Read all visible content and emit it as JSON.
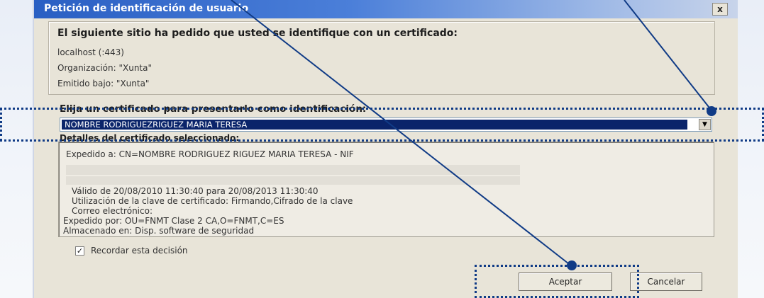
{
  "dialog": {
    "title": "Petición de identificación de usuario",
    "close_label": "x"
  },
  "site_info": {
    "heading": "El siguiente sitio ha pedido que usted se identifique con un certificado:",
    "host": "localhost (:443)",
    "organization": "Organización: \"Xunta\"",
    "issued_under": "Emitido bajo: \"Xunta\""
  },
  "certificate": {
    "choose_label": "Elija un certificado para presentarlo como identificación:",
    "selected": "NOMBRE RODRIGUEZRIGUEZ MARIA TERESA",
    "details_label": "Detalles del certificado seleccionado:",
    "details": [
      "Expedido a: CN=NOMBRE RODRIGUEZ RIGUEZ MARIA TERESA - NIF",
      "Válido de 20/08/2010 11:30:40 para 20/08/2013 11:30:40",
      "Utilización de la clave de certificado: Firmando,Cifrado de la clave",
      "Correo electrónico:",
      "Expedido por: OU=FNMT Clase 2 CA,O=FNMT,C=ES",
      "Almacenado en: Disp. software de seguridad"
    ]
  },
  "remember": {
    "label": "Recordar esta decisión",
    "checked": true
  },
  "buttons": {
    "accept": "Aceptar",
    "cancel": "Cancelar"
  },
  "colors": {
    "title_bar": "#2a5fc3",
    "selection": "#0a246a",
    "annotation": "#103b86"
  }
}
